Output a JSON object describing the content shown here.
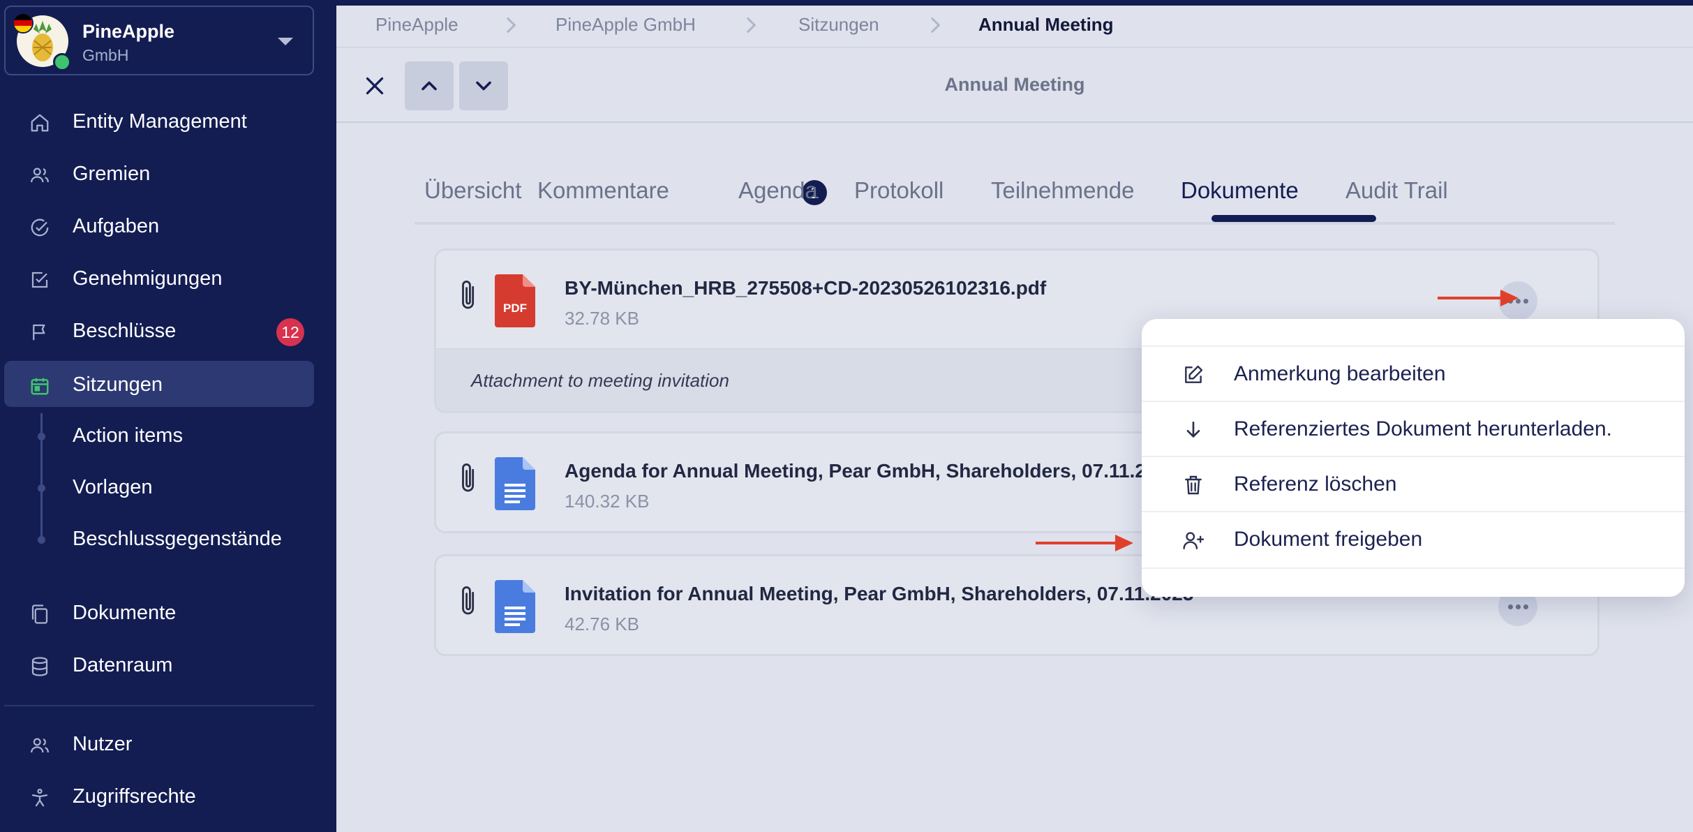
{
  "org": {
    "name": "PineApple",
    "sub": "GmbH"
  },
  "sidebar": {
    "items": [
      {
        "label": "Entity Management",
        "icon": "home-icon"
      },
      {
        "label": "Gremien",
        "icon": "users-icon"
      },
      {
        "label": "Aufgaben",
        "icon": "check-circle-icon"
      },
      {
        "label": "Genehmigungen",
        "icon": "check-square-icon"
      },
      {
        "label": "Beschlüsse",
        "icon": "flag-icon",
        "badge": "12"
      },
      {
        "label": "Sitzungen",
        "icon": "calendar-icon",
        "active": true
      }
    ],
    "sub_items": [
      "Action items",
      "Vorlagen",
      "Beschlussgegenstände"
    ],
    "lower_items": [
      {
        "label": "Dokumente",
        "icon": "documents-icon"
      },
      {
        "label": "Datenraum",
        "icon": "database-icon"
      }
    ],
    "bottom_items": [
      {
        "label": "Nutzer",
        "icon": "users-icon"
      },
      {
        "label": "Zugriffsrechte",
        "icon": "accessibility-icon"
      }
    ]
  },
  "breadcrumb": [
    "PineApple",
    "PineApple GmbH",
    "Sitzungen",
    "Annual Meeting"
  ],
  "header": {
    "title": "Annual Meeting"
  },
  "tabs": [
    {
      "label": "Übersicht"
    },
    {
      "label": "Kommentare",
      "badge": "1"
    },
    {
      "label": "Agenda"
    },
    {
      "label": "Protokoll"
    },
    {
      "label": "Teilnehmende"
    },
    {
      "label": "Dokumente",
      "active": true
    },
    {
      "label": "Audit Trail"
    }
  ],
  "documents": [
    {
      "name": "BY-München_HRB_275508+CD-20230526102316.pdf",
      "size": "32.78 KB",
      "type": "pdf",
      "type_label": "PDF",
      "note": "Attachment to meeting invitation"
    },
    {
      "name": "Agenda for Annual Meeting, Pear GmbH, Shareholders, 07.11.2",
      "size": "140.32 KB",
      "type": "doc"
    },
    {
      "name": "Invitation for Annual Meeting, Pear GmbH, Shareholders, 07.11.2023",
      "size": "42.76 KB",
      "type": "doc"
    }
  ],
  "menu": {
    "items": [
      {
        "label": "Anmerkung bearbeiten",
        "icon": "edit-icon"
      },
      {
        "label": "Referenziertes Dokument herunterladen.",
        "icon": "arrow-down-icon"
      },
      {
        "label": "Referenz löschen",
        "icon": "trash-icon"
      },
      {
        "label": "Dokument freigeben",
        "icon": "user-plus-icon"
      }
    ]
  },
  "colors": {
    "sidebar_bg": "#131d52",
    "accent": "#131d52",
    "badge_red": "#d8324f",
    "annotation_arrow": "#e0402a",
    "pdf_red": "#d63b2f",
    "doc_blue": "#4a7ce0"
  }
}
